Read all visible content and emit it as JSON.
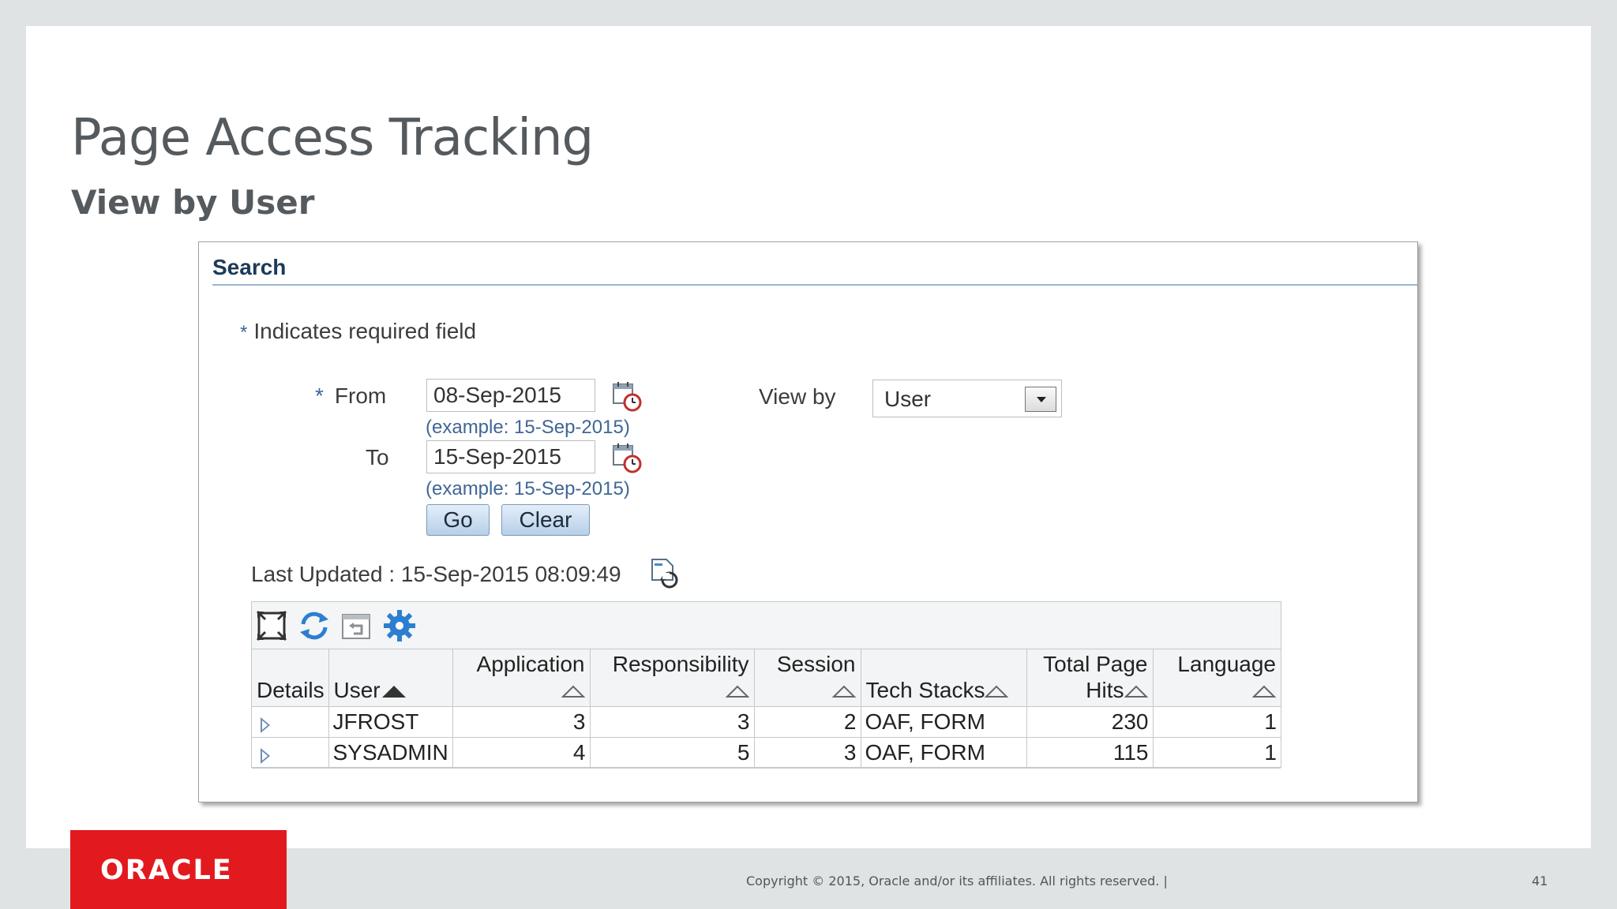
{
  "slide": {
    "title": "Page Access Tracking",
    "subtitle": "View by User"
  },
  "search": {
    "header": "Search",
    "required_note": "Indicates required field",
    "required_marker": "*",
    "from_label": "From",
    "from_value": "08-Sep-2015",
    "from_hint": "(example: 15-Sep-2015)",
    "to_label": "To",
    "to_value": "15-Sep-2015",
    "to_hint": "(example: 15-Sep-2015)",
    "view_by_label": "View by",
    "view_by_value": "User",
    "go_label": "Go",
    "clear_label": "Clear"
  },
  "last_updated": {
    "text": "Last Updated : 15-Sep-2015 08:09:49"
  },
  "table": {
    "toolbar_icons": [
      "detach-icon",
      "refresh-icon",
      "reset-icon",
      "settings-icon"
    ],
    "headers": {
      "details": "Details",
      "user": "User",
      "application": "Application",
      "responsibility": "Responsibility",
      "session": "Session",
      "tech_stacks": "Tech Stacks",
      "total_page_hits_1": "Total Page",
      "total_page_hits_2": "Hits",
      "language": "Language"
    },
    "rows": [
      {
        "user": "JFROST",
        "application": "3",
        "responsibility": "3",
        "session": "2",
        "tech_stacks": "OAF, FORM",
        "total_page_hits": "230",
        "language": "1"
      },
      {
        "user": "SYSADMIN",
        "application": "4",
        "responsibility": "5",
        "session": "3",
        "tech_stacks": "OAF, FORM",
        "total_page_hits": "115",
        "language": "1"
      }
    ]
  },
  "footer": {
    "logo_text": "ORACLE",
    "copyright": "Copyright © 2015, Oracle and/or its affiliates. All rights reserved.  |",
    "page_number": "41"
  },
  "colors": {
    "brand_red": "#e21a1e",
    "link_blue": "#1f5da6",
    "hint_blue": "#3f6696"
  }
}
